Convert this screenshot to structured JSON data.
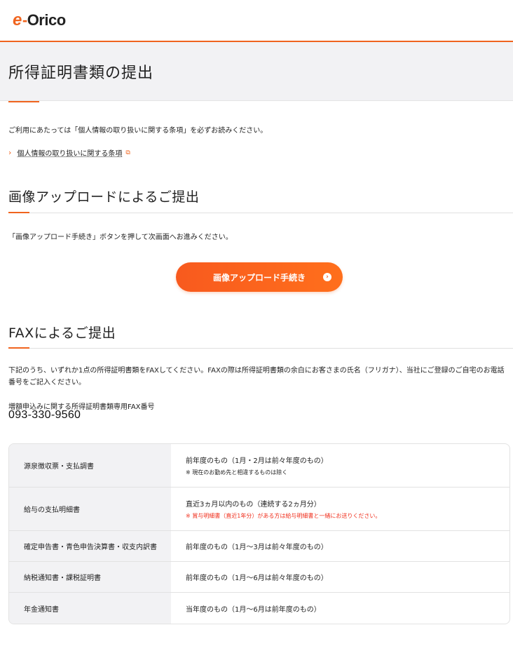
{
  "header": {
    "logo_e": "e",
    "logo_dash": "-",
    "logo_text": "Orico"
  },
  "page": {
    "title": "所得証明書類の提出"
  },
  "notice": {
    "text": "ご利用にあたっては「個人情報の取り扱いに関する条項」を必ずお読みください。"
  },
  "privacy_link": {
    "label": "個人情報の取り扱いに関する条項"
  },
  "upload_section": {
    "heading": "画像アップロードによるご提出",
    "instruction": "「画像アップロード手続き」ボタンを押して次画面へお進みください。",
    "button_label": "画像アップロード手続き"
  },
  "fax_section": {
    "heading": "FAXによるご提出",
    "description": "下記のうち、いずれか1点の所得証明書類をFAXしてください。FAXの際は所得証明書類の余白にお客さまの氏名（フリガナ）、当社にご登録のご自宅のお電話番号をご記入ください。",
    "fax_label": "増額申込みに関する所得証明書類専用FAX番号",
    "fax_number": "093-330-9560"
  },
  "documents": [
    {
      "name": "源泉徴収票・支払調書",
      "condition": "前年度のもの（1月・2月は前々年度のもの）",
      "note": "※ 現在のお勤め先と相違するものは除く"
    },
    {
      "name": "給与の支払明細書",
      "condition": "直近3ヵ月以内のもの（連続する2ヵ月分）",
      "note": "※ 賞与明細書（直近1年分）がある方は給与明細書と一緒にお送りください。"
    },
    {
      "name": "確定申告書・青色申告決算書・収支内訳書",
      "condition": "前年度のもの（1月〜3月は前々年度のもの）"
    },
    {
      "name": "納税通知書・課税証明書",
      "condition": "前年度のもの（1月〜6月は前々年度のもの）"
    },
    {
      "name": "年金通知書",
      "condition": "当年度のもの（1月〜6月は前年度のもの）"
    }
  ],
  "colors": {
    "accent": "#f0641e",
    "note_red": "#f0301e",
    "band_gray": "#f2f2f4"
  },
  "icons": {
    "link_chevron": "chevron-right-icon",
    "external": "external-link-icon",
    "button_arrow": "arrow-circle-right-icon"
  }
}
